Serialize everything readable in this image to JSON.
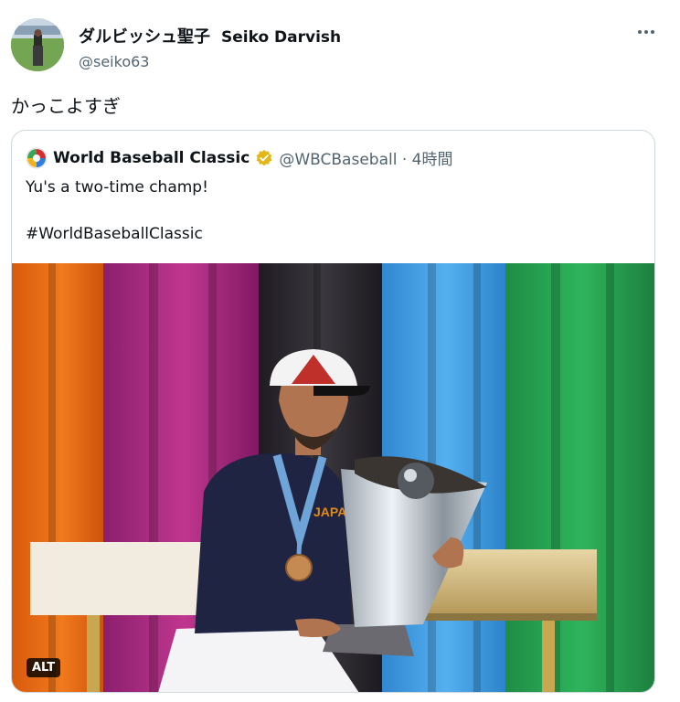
{
  "author": {
    "display_name": "ダルビッシュ聖子",
    "display_name_en": "Seiko Darvish",
    "handle": "@seiko63"
  },
  "tweet": {
    "text": "かっこよすぎ"
  },
  "quoted": {
    "name": "World Baseball Classic",
    "handle_time": "@WBCBaseball · 4時間",
    "line1": "Yu's a two-time champ!",
    "line2": "#WorldBaseballClassic"
  },
  "media": {
    "alt_label": "ALT"
  },
  "colors": {
    "verified": "#e2b719",
    "text_secondary": "#536471",
    "border": "#cfd9de"
  },
  "icons": [
    "more-icon",
    "verified-badge-icon",
    "wbc-logo-icon"
  ]
}
